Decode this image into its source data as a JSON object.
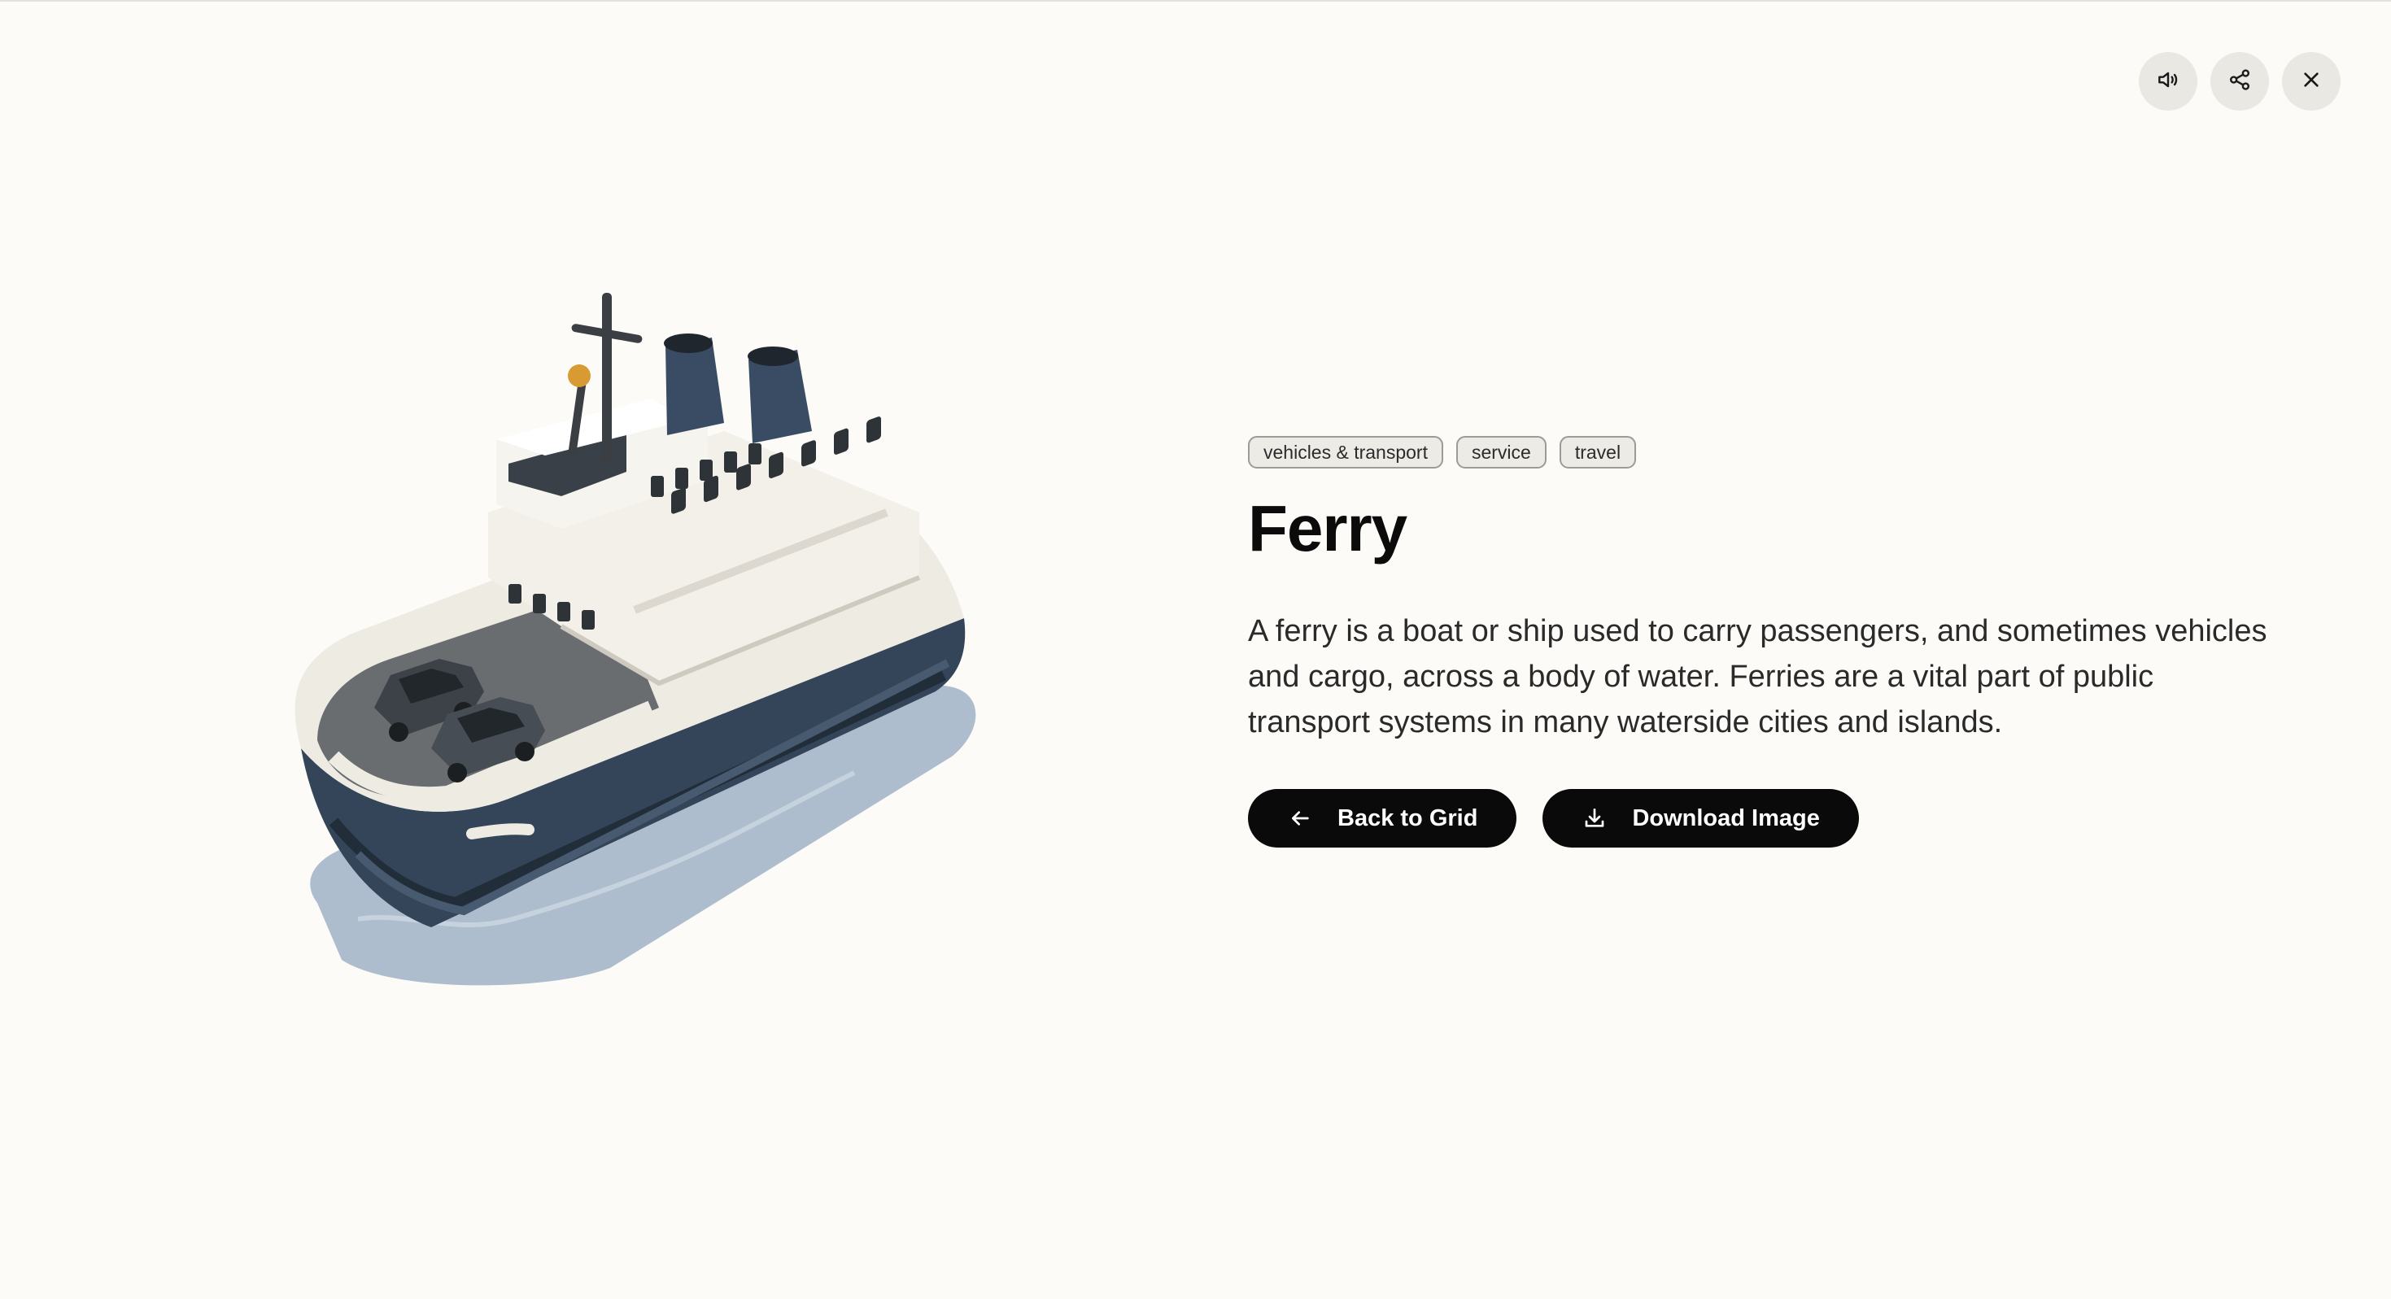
{
  "controls": [
    {
      "name": "speaker-icon"
    },
    {
      "name": "share-icon"
    },
    {
      "name": "close-icon"
    }
  ],
  "illustration": {
    "subject": "ferry",
    "colors": {
      "hull": "#344559",
      "deck": "#efece4",
      "water": "#9fb2c6",
      "windows": "#2e3338",
      "accent": "#d89a32"
    }
  },
  "tags": [
    "vehicles & transport",
    "service",
    "travel"
  ],
  "title": "Ferry",
  "description": "A ferry is a boat or ship used to carry passengers, and sometimes vehicles and cargo, across a body of water. Ferries are a vital part of public transport systems in many waterside cities and islands.",
  "buttons": {
    "back": {
      "label": "Back to Grid",
      "icon": "arrow-left-icon"
    },
    "download": {
      "label": "Download Image",
      "icon": "download-icon"
    }
  }
}
